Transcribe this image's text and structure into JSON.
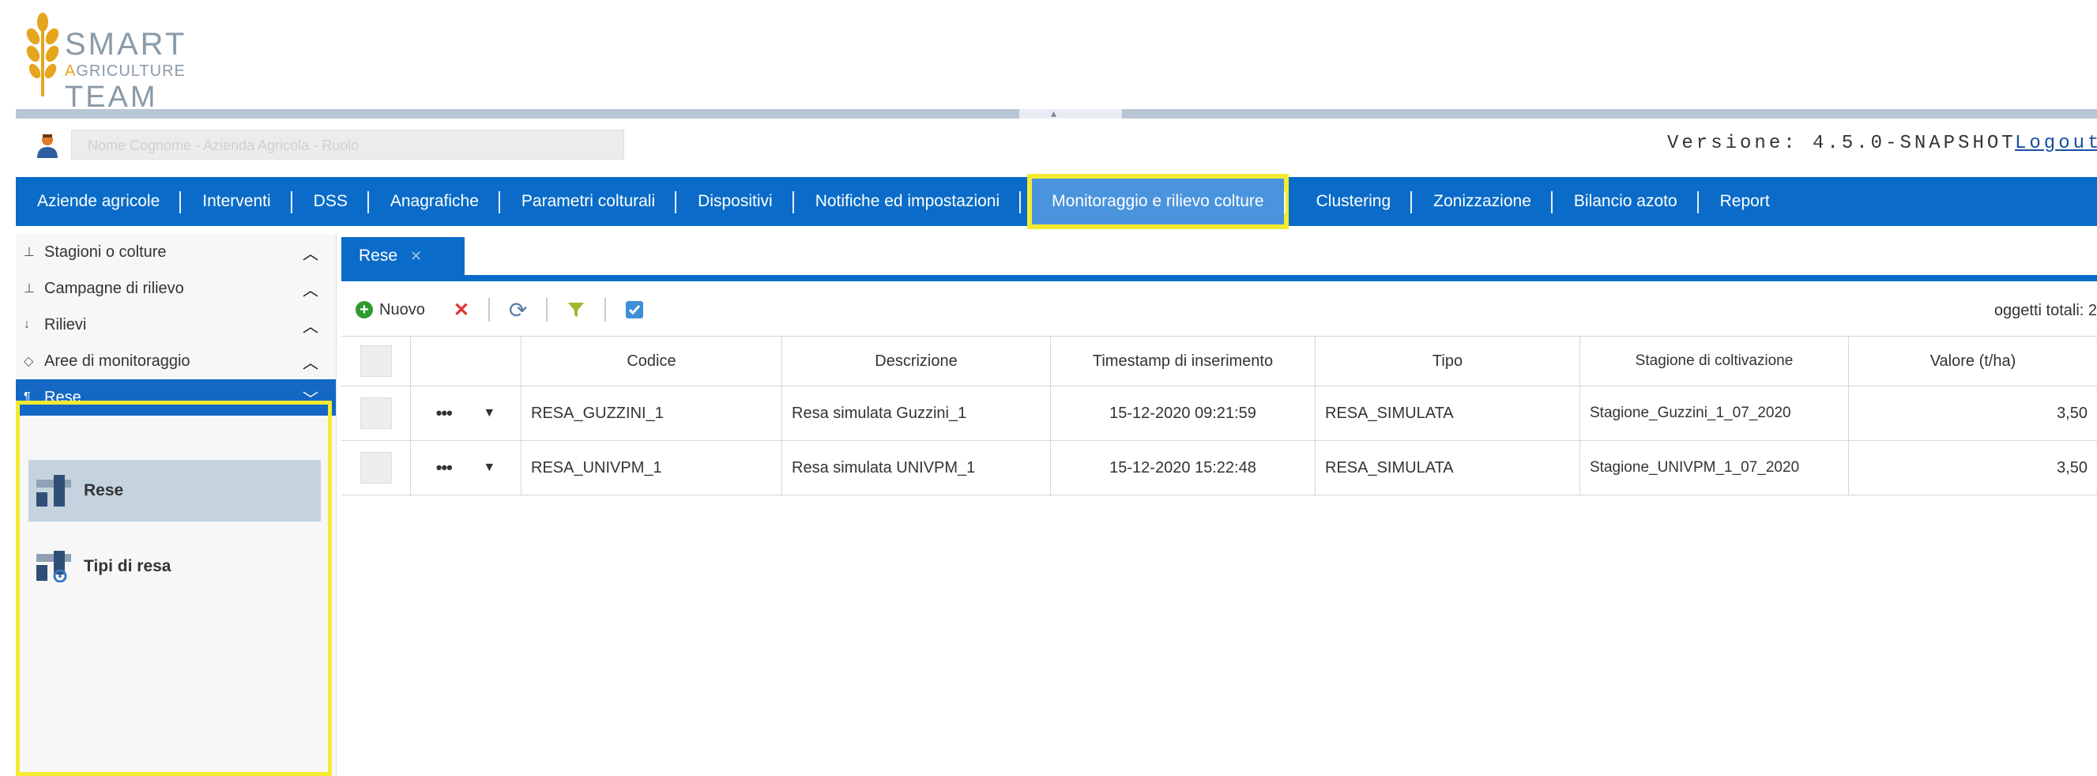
{
  "logo": {
    "line1": "SMART",
    "line2_first": "A",
    "line2_rest": "GRICULTURE",
    "line3": "TEAM"
  },
  "userbar": {
    "user_text": "Nome Cognome - Azienda Agricola - Ruolo",
    "version": "Versione: 4.5.0-SNAPSHOT",
    "logout": "Logout"
  },
  "nav": {
    "items": [
      "Aziende agricole",
      "Interventi",
      "DSS",
      "Anagrafiche",
      "Parametri colturali",
      "Dispositivi",
      "Notifiche ed impostazioni",
      "Monitoraggio e rilievo colture",
      "Clustering",
      "Zonizzazione",
      "Bilancio azoto",
      "Report"
    ],
    "active": "Monitoraggio e rilievo colture"
  },
  "sidebar": {
    "items": [
      {
        "label": "Stagioni o colture",
        "icon": "hierarchy-icon",
        "state": "collapsed"
      },
      {
        "label": "Campagne di rilievo",
        "icon": "hierarchy-icon",
        "state": "collapsed"
      },
      {
        "label": "Rilievi",
        "icon": "arrow-down-icon",
        "state": "collapsed"
      },
      {
        "label": "Aree di monitoraggio",
        "icon": "eye-icon",
        "state": "collapsed"
      },
      {
        "label": "Rese",
        "icon": "flag-icon",
        "state": "expanded"
      }
    ],
    "sub_items": [
      {
        "label": "Rese",
        "icon": "bar-block-icon",
        "active": true
      },
      {
        "label": "Tipi di resa",
        "icon": "bar-block-gear-icon",
        "active": false
      }
    ]
  },
  "tabs": [
    {
      "label": "Rese",
      "close": "✕"
    }
  ],
  "toolbar": {
    "new_label": "Nuovo",
    "total_text": "oggetti totali: 2"
  },
  "grid": {
    "columns": [
      "Codice",
      "Descrizione",
      "Timestamp di inserimento",
      "Tipo",
      "Stagione di coltivazione",
      "Valore (t/ha)"
    ],
    "rows": [
      {
        "codice": "RESA_GUZZINI_1",
        "descrizione": "Resa simulata Guzzini_1",
        "timestamp": "15-12-2020 09:21:59",
        "tipo": "RESA_SIMULATA",
        "stagione": "Stagione_Guzzini_1_07_2020",
        "valore": "3,50"
      },
      {
        "codice": "RESA_UNIVPM_1",
        "descrizione": "Resa simulata UNIVPM_1",
        "timestamp": "15-12-2020 15:22:48",
        "tipo": "RESA_SIMULATA",
        "stagione": "Stagione_UNIVPM_1_07_2020",
        "valore": "3,50"
      }
    ]
  },
  "colors": {
    "nav_blue": "#0a6cc8",
    "highlight_yellow": "#f4ea2f",
    "active_sub": "#c5d3df"
  }
}
